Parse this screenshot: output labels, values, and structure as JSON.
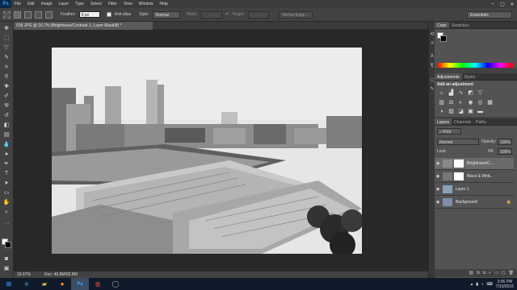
{
  "app": {
    "logo": "Ps"
  },
  "menu": [
    "File",
    "Edit",
    "Image",
    "Layer",
    "Type",
    "Select",
    "Filter",
    "View",
    "Window",
    "Help"
  ],
  "window_controls": [
    "–",
    "▢",
    "✕"
  ],
  "options": {
    "feather_label": "Feather:",
    "feather_value": "0 px",
    "antialias_label": "Anti-alias",
    "style_label": "Style:",
    "style_value": "Normal",
    "width_label": "Width:",
    "height_label": "Height:",
    "refine_edge": "Refine Edge...",
    "workspace": "Essentials"
  },
  "document": {
    "tab_title": "018.JPG @ 16.7% (Brightness/Contrast 1, Layer Mask/8) *",
    "zoom": "16.67%",
    "doc_size": "Doc: 46.8M/92.8M"
  },
  "panels": {
    "color_tabs": [
      "Color",
      "Swatches"
    ],
    "adjustments_tabs": [
      "Adjustments",
      "Styles"
    ],
    "adjustments_title": "Add an adjustment",
    "layers_tabs": [
      "Layers",
      "Channels",
      "Paths"
    ],
    "kind_label": "Kind",
    "blend_mode": "Normal",
    "opacity_label": "Opacity:",
    "opacity_value": "100%",
    "lock_label": "Lock:",
    "fill_label": "Fill:",
    "fill_value": "100%"
  },
  "layers": [
    {
      "name": "Brightness/C...",
      "selected": true
    },
    {
      "name": "Black & Whit...",
      "selected": false
    },
    {
      "name": "Layer 1",
      "selected": false
    },
    {
      "name": "Background",
      "selected": false
    }
  ],
  "taskbar": {
    "apps": [
      "windows-start",
      "internet-explorer",
      "file-explorer",
      "firefox",
      "photoshop",
      "chrome",
      "media-app"
    ],
    "time": "3:06 PM",
    "date": "7/10/2016"
  },
  "colors": {
    "ps_blue": "#31a8ff",
    "ui_dark": "#424242",
    "canvas_bg": "#282828",
    "panel": "#535353",
    "taskbar": "#101a2a"
  }
}
